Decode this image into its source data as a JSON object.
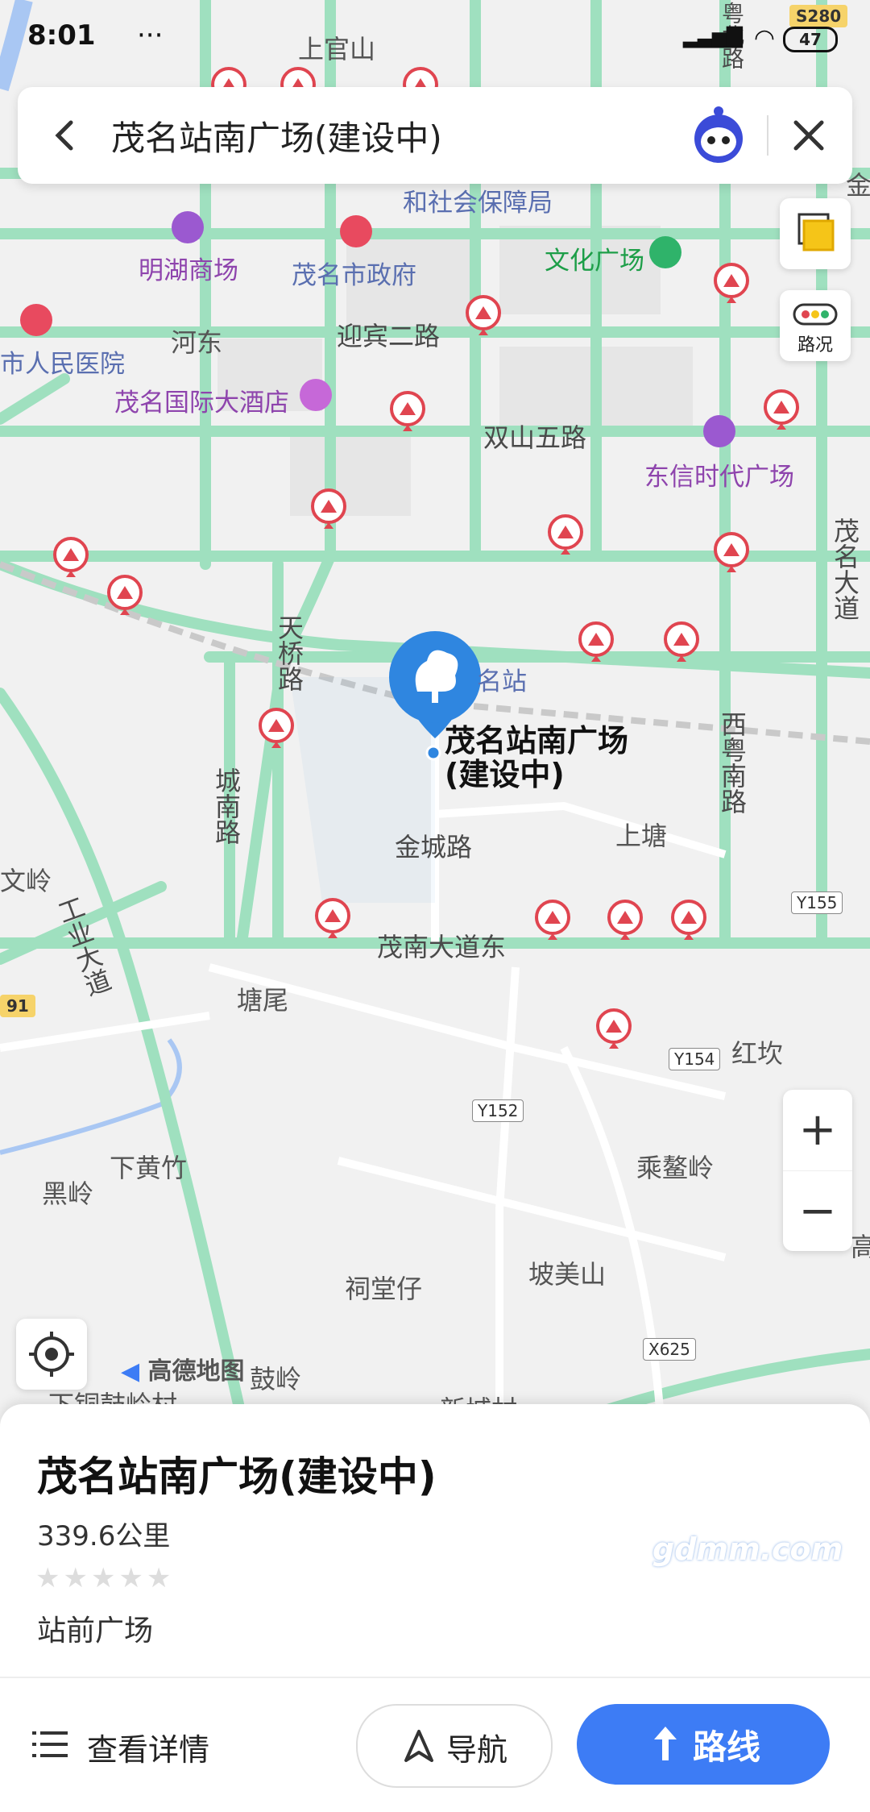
{
  "status_bar": {
    "time": "8:01",
    "extra": "···",
    "battery": "47"
  },
  "search": {
    "title": "茂名站南广场(建设中)"
  },
  "map": {
    "labels": {
      "shanguanshan": "上官山",
      "yue_bei_lu": "粤北路",
      "s280": "S280",
      "hexi": "和社会保障局",
      "minghu": "明湖商场",
      "maoming_gov": "茂名市政府",
      "wenhua": "文化广场",
      "renmin": "市人民医院",
      "hedong": "河东",
      "yingbin": "迎宾二路",
      "intl_hotel": "茂名国际大酒店",
      "shuangshan": "双山五路",
      "dongxin": "东信时代广场",
      "maoming_dadao": "茂名大道",
      "tianqiao": "天桥路",
      "station": "名站",
      "xiyue": "西粤南路",
      "chengnan": "城南路",
      "poi_name": "茂名站南广场",
      "poi_sub": "(建设中)",
      "shangtang": "上塘",
      "jincheng": "金城路",
      "wenling": "文岭",
      "y155": "Y155",
      "gongye": "工业大道",
      "maonan": "茂南大道东",
      "tangwei": "塘尾",
      "hwy91": "91",
      "hongkan": "红坎",
      "y154": "Y154",
      "y152": "Y152",
      "xiahuangzhu": "下黄竹",
      "chengaoling": "乘鳌岭",
      "heiling": "黑岭",
      "citangzai": "祠堂仔",
      "pomeishan": "坡美山",
      "x625": "X625",
      "xincheng": "新城村",
      "gao": "高",
      "jin": "金",
      "xiatonggu": "下铜鼓岭村",
      "ling": "鼓岭"
    },
    "traffic_label": "路况",
    "logo": "高德地图"
  },
  "place": {
    "name": "茂名站南广场(建设中)",
    "distance": "339.6公里",
    "category": "站前广场"
  },
  "actions": {
    "details": "查看详情",
    "navigate": "导航",
    "route": "路线"
  },
  "watermark": "gdmm.com",
  "colors": {
    "road": "#9fe0bf",
    "accent": "#3d7cf5",
    "pin": "#2f86e0",
    "construction": "#e04550"
  }
}
